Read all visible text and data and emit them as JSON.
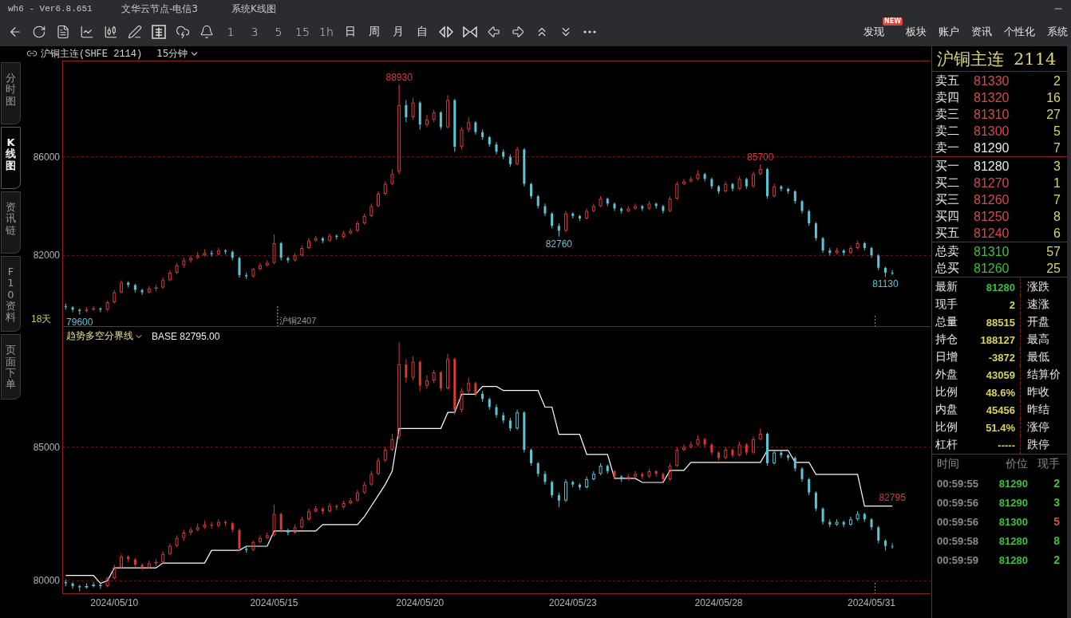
{
  "window": {
    "title": "wh6 - Ver6.8.651",
    "server": "文华云节点-电信3",
    "view": "系统K线图"
  },
  "toolbar": {
    "periods": [
      "1",
      "3",
      "5",
      "15",
      "1h",
      "日",
      "周",
      "月",
      "自"
    ],
    "menu": [
      {
        "label": "发现",
        "badge": "NEW"
      },
      {
        "label": "板块"
      },
      {
        "label": "账户"
      },
      {
        "label": "资讯"
      },
      {
        "label": "个性化"
      },
      {
        "label": "系统"
      }
    ]
  },
  "symbol_bar": {
    "symbol": "沪铜主连(SHFE 2114)",
    "period": "15分钟"
  },
  "side_tabs": [
    {
      "label": "分时图",
      "selected": false
    },
    {
      "label": "K线图",
      "selected": true
    },
    {
      "label": "资讯链",
      "selected": false
    },
    {
      "label": "F10资料",
      "selected": false
    },
    {
      "label": "页面下单",
      "selected": false
    }
  ],
  "price_chart": {
    "corner_label": "18天",
    "chart_data": {
      "type": "candlestick",
      "ohlc": [
        [
          79950,
          80050,
          79800,
          79900
        ],
        [
          79900,
          79950,
          79700,
          79800
        ],
        [
          79800,
          79850,
          79600,
          79750
        ],
        [
          79750,
          79900,
          79700,
          79800
        ],
        [
          79800,
          79950,
          79750,
          79850
        ],
        [
          79850,
          79900,
          79700,
          79800
        ],
        [
          79800,
          80150,
          79750,
          80100
        ],
        [
          80100,
          80600,
          80050,
          80500
        ],
        [
          80500,
          81000,
          80450,
          80900
        ],
        [
          80900,
          80950,
          80700,
          80800
        ],
        [
          80800,
          80850,
          80500,
          80600
        ],
        [
          80600,
          80650,
          80400,
          80500
        ],
        [
          80500,
          80750,
          80450,
          80650
        ],
        [
          80650,
          80800,
          80550,
          80700
        ],
        [
          80700,
          81100,
          80650,
          81000
        ],
        [
          81000,
          81400,
          80950,
          81300
        ],
        [
          81300,
          81700,
          81250,
          81600
        ],
        [
          81600,
          81900,
          81500,
          81800
        ],
        [
          81800,
          82000,
          81700,
          81900
        ],
        [
          81900,
          82150,
          81850,
          82000
        ],
        [
          82000,
          82250,
          81950,
          82100
        ],
        [
          82100,
          82200,
          81950,
          82050
        ],
        [
          82050,
          82300,
          82000,
          82200
        ],
        [
          82200,
          82250,
          82050,
          82150
        ],
        [
          82150,
          82200,
          81800,
          81900
        ],
        [
          81900,
          81950,
          81100,
          81200
        ],
        [
          81200,
          81300,
          81050,
          81150
        ],
        [
          81150,
          81500,
          81100,
          81450
        ],
        [
          81450,
          81700,
          81400,
          81600
        ],
        [
          81600,
          81800,
          81550,
          81700
        ],
        [
          81700,
          82850,
          81650,
          82500
        ],
        [
          82500,
          82550,
          81800,
          81900
        ],
        [
          81900,
          81950,
          81700,
          81800
        ],
        [
          81800,
          82100,
          81750,
          82000
        ],
        [
          82000,
          82400,
          81950,
          82300
        ],
        [
          82300,
          82700,
          82250,
          82600
        ],
        [
          82600,
          82800,
          82550,
          82700
        ],
        [
          82700,
          82750,
          82500,
          82600
        ],
        [
          82600,
          82900,
          82550,
          82800
        ],
        [
          82800,
          82850,
          82650,
          82750
        ],
        [
          82750,
          83000,
          82700,
          82900
        ],
        [
          82900,
          83100,
          82850,
          83000
        ],
        [
          83000,
          83400,
          82950,
          83300
        ],
        [
          83300,
          83700,
          83250,
          83600
        ],
        [
          83600,
          84100,
          83550,
          84000
        ],
        [
          84000,
          84600,
          83950,
          84500
        ],
        [
          84500,
          85000,
          84450,
          84900
        ],
        [
          84900,
          85500,
          84850,
          85300
        ],
        [
          85400,
          88930,
          85300,
          88100
        ],
        [
          88100,
          88300,
          87400,
          87600
        ],
        [
          87600,
          88400,
          87500,
          88200
        ],
        [
          88200,
          88250,
          87100,
          87300
        ],
        [
          87300,
          87700,
          87200,
          87500
        ],
        [
          87500,
          87900,
          87400,
          87800
        ],
        [
          87800,
          87850,
          87100,
          87200
        ],
        [
          87200,
          88500,
          87150,
          88300
        ],
        [
          88300,
          88350,
          86200,
          86400
        ],
        [
          86400,
          87200,
          86300,
          87100
        ],
        [
          87100,
          87600,
          87000,
          87400
        ],
        [
          87400,
          87450,
          86900,
          87000
        ],
        [
          87000,
          87100,
          86700,
          86800
        ],
        [
          86800,
          86850,
          86400,
          86500
        ],
        [
          86500,
          86600,
          86100,
          86200
        ],
        [
          86200,
          86300,
          85900,
          86000
        ],
        [
          86000,
          86100,
          85600,
          85700
        ],
        [
          85700,
          86400,
          85650,
          86300
        ],
        [
          86300,
          86350,
          84800,
          84900
        ],
        [
          84900,
          84950,
          84300,
          84400
        ],
        [
          84400,
          84450,
          83900,
          84000
        ],
        [
          84000,
          84100,
          83600,
          83700
        ],
        [
          83700,
          83750,
          83100,
          83200
        ],
        [
          83200,
          83300,
          82760,
          83000
        ],
        [
          83000,
          83800,
          82950,
          83700
        ],
        [
          83700,
          83750,
          83500,
          83600
        ],
        [
          83600,
          83650,
          83400,
          83500
        ],
        [
          83500,
          83900,
          83450,
          83800
        ],
        [
          83800,
          84100,
          83750,
          84000
        ],
        [
          84000,
          84400,
          83950,
          84300
        ],
        [
          84300,
          84350,
          84000,
          84100
        ],
        [
          84100,
          84150,
          83800,
          83900
        ],
        [
          83900,
          83950,
          83700,
          83800
        ],
        [
          83800,
          84000,
          83750,
          83900
        ],
        [
          83900,
          84100,
          83850,
          84000
        ],
        [
          84000,
          84050,
          83800,
          83900
        ],
        [
          83900,
          84200,
          83850,
          84100
        ],
        [
          84100,
          84150,
          83900,
          84000
        ],
        [
          84000,
          84050,
          83700,
          83800
        ],
        [
          83800,
          84400,
          83750,
          84300
        ],
        [
          84300,
          85000,
          84250,
          84900
        ],
        [
          84900,
          85100,
          84850,
          85000
        ],
        [
          85000,
          85200,
          84950,
          85100
        ],
        [
          85100,
          85450,
          85050,
          85300
        ],
        [
          85300,
          85350,
          85000,
          85100
        ],
        [
          85100,
          85150,
          84700,
          84800
        ],
        [
          84800,
          84850,
          84500,
          84600
        ],
        [
          84600,
          85000,
          84550,
          84900
        ],
        [
          84900,
          84950,
          84600,
          84700
        ],
        [
          84700,
          85200,
          84650,
          85100
        ],
        [
          85100,
          85150,
          84700,
          84800
        ],
        [
          84800,
          85400,
          84750,
          85300
        ],
        [
          85300,
          85700,
          85250,
          85500
        ],
        [
          85500,
          85550,
          84300,
          84400
        ],
        [
          84400,
          84900,
          84350,
          84800
        ],
        [
          84800,
          84850,
          84600,
          84700
        ],
        [
          84700,
          84750,
          84500,
          84600
        ],
        [
          84600,
          84650,
          84100,
          84200
        ],
        [
          84200,
          84250,
          83700,
          83800
        ],
        [
          83800,
          83850,
          83200,
          83300
        ],
        [
          83300,
          83350,
          82600,
          82700
        ],
        [
          82700,
          82750,
          82100,
          82200
        ],
        [
          82200,
          82300,
          82000,
          82100
        ],
        [
          82100,
          82300,
          82050,
          82200
        ],
        [
          82200,
          82250,
          82000,
          82100
        ],
        [
          82100,
          82400,
          82050,
          82300
        ],
        [
          82300,
          82600,
          82250,
          82500
        ],
        [
          82500,
          82550,
          82200,
          82300
        ],
        [
          82300,
          82350,
          81900,
          82000
        ],
        [
          82000,
          82050,
          81400,
          81500
        ],
        [
          81500,
          81550,
          81130,
          81300
        ],
        [
          81300,
          81400,
          81200,
          81280
        ]
      ],
      "categories": [
        null,
        null,
        null,
        null,
        null,
        null,
        null,
        "2024/05/10",
        null,
        null,
        null,
        null,
        null,
        null,
        null,
        null,
        null,
        null,
        null,
        null,
        null,
        null,
        null,
        null,
        null,
        null,
        null,
        null,
        null,
        null,
        "2024/05/15",
        null,
        null,
        null,
        null,
        null,
        null,
        null,
        null,
        null,
        null,
        null,
        null,
        null,
        null,
        null,
        null,
        null,
        null,
        null,
        null,
        "2024/05/20",
        null,
        null,
        null,
        null,
        null,
        null,
        null,
        null,
        null,
        null,
        null,
        null,
        null,
        null,
        null,
        null,
        null,
        null,
        null,
        null,
        null,
        "2024/05/23",
        null,
        null,
        null,
        null,
        null,
        null,
        null,
        null,
        null,
        null,
        null,
        null,
        null,
        null,
        null,
        null,
        null,
        null,
        null,
        null,
        "2024/05/28",
        null,
        null,
        null,
        null,
        null,
        null,
        null,
        null,
        null,
        null,
        null,
        null,
        null,
        null,
        null,
        null,
        null,
        null,
        null,
        null,
        null,
        "2024/05/31",
        null,
        null,
        null
      ],
      "ylim": [
        79100,
        89900
      ],
      "yticks": [
        82000,
        86000
      ],
      "tick_labels": "y",
      "grid": true,
      "ref_lines": [
        {
          "axis": "x",
          "value": "2024/05/15",
          "label": "沪铜2407",
          "line_style": "dotted"
        }
      ],
      "annotations": [
        "88930",
        "85700",
        "82760",
        "81130",
        "79600"
      ]
    }
  },
  "indicator": {
    "name": "趋势多空分界线",
    "base": "BASE 82795.00",
    "chart_data": {
      "type": "candlestick",
      "series": [
        {
          "type": "line",
          "color": "#ffffff",
          "values": [
            80200,
            80200,
            80200,
            80200,
            80200,
            79900,
            80000,
            80480,
            80480,
            80480,
            80480,
            80480,
            80480,
            80480,
            80660,
            80660,
            80660,
            80660,
            80660,
            80660,
            80660,
            81140,
            81140,
            81140,
            81140,
            81140,
            81290,
            81290,
            81290,
            81290,
            81860,
            81860,
            81860,
            81860,
            81860,
            81860,
            81860,
            82100,
            82100,
            82100,
            82100,
            82100,
            82100,
            82400,
            82800,
            83200,
            83600,
            84100,
            85700,
            85700,
            85700,
            85700,
            85700,
            85700,
            85700,
            86300,
            86300,
            86980,
            86980,
            86980,
            87270,
            87270,
            87270,
            87120,
            87120,
            87120,
            87120,
            87120,
            87120,
            86500,
            86500,
            85480,
            85480,
            85480,
            85480,
            84730,
            84730,
            84730,
            84730,
            83830,
            83830,
            83830,
            83830,
            83680,
            83680,
            83680,
            83680,
            84130,
            84130,
            84130,
            84430,
            84430,
            84430,
            84430,
            84430,
            84430,
            84430,
            84430,
            84430,
            84430,
            84430,
            84880,
            84880,
            84880,
            84880,
            84430,
            84430,
            84430,
            83980,
            83980,
            83980,
            83980,
            83980,
            83980,
            83980,
            82795,
            82795,
            82795,
            82795,
            82795
          ]
        },
        {
          "type": "candlestick",
          "color": "#d83a3a",
          "ohlc": [
            null,
            null,
            null,
            null,
            null,
            null,
            [
              79800,
              80150,
              79750,
              80100
            ],
            [
              80100,
              80600,
              80050,
              80500
            ],
            [
              80500,
              81000,
              80450,
              80900
            ],
            [
              80900,
              80950,
              80700,
              80800
            ],
            [
              80800,
              80850,
              80500,
              80600
            ],
            [
              80600,
              80650,
              80400,
              80500
            ],
            [
              80500,
              80750,
              80450,
              80650
            ],
            [
              80650,
              80800,
              80550,
              80700
            ],
            [
              80700,
              81100,
              80650,
              81000
            ],
            [
              81000,
              81400,
              80950,
              81300
            ],
            [
              81300,
              81700,
              81250,
              81600
            ],
            [
              81600,
              81900,
              81500,
              81800
            ],
            [
              81800,
              82000,
              81700,
              81900
            ],
            [
              81900,
              82150,
              81850,
              82000
            ],
            [
              82000,
              82250,
              81950,
              82100
            ],
            [
              82100,
              82200,
              81950,
              82050
            ],
            [
              82050,
              82300,
              82000,
              82200
            ],
            [
              82200,
              82250,
              82050,
              82150
            ],
            [
              82150,
              82200,
              81800,
              81900
            ],
            [
              81900,
              81950,
              81100,
              81200
            ],
            null,
            [
              81150,
              81500,
              81100,
              81450
            ],
            [
              81450,
              81700,
              81400,
              81600
            ],
            [
              81600,
              81800,
              81550,
              81700
            ],
            [
              81700,
              82850,
              81650,
              82500
            ],
            [
              82500,
              82550,
              81800,
              81900
            ],
            null,
            [
              81800,
              82100,
              81750,
              82000
            ],
            [
              82000,
              82400,
              81950,
              82300
            ],
            [
              82300,
              82700,
              82250,
              82600
            ],
            [
              82600,
              82800,
              82550,
              82700
            ],
            [
              82700,
              82750,
              82500,
              82600
            ],
            [
              82600,
              82900,
              82550,
              82800
            ],
            [
              82800,
              82850,
              82650,
              82750
            ],
            [
              82750,
              83000,
              82700,
              82900
            ],
            [
              82900,
              83100,
              82850,
              83000
            ],
            [
              83000,
              83400,
              82950,
              83300
            ],
            [
              83300,
              83700,
              83250,
              83600
            ],
            [
              83600,
              84100,
              83550,
              84000
            ],
            [
              84000,
              84600,
              83950,
              84500
            ],
            [
              84500,
              85000,
              84450,
              84900
            ],
            [
              84900,
              85500,
              84850,
              85300
            ],
            [
              85400,
              88930,
              85300,
              88100
            ],
            [
              88100,
              88300,
              87400,
              87600
            ],
            [
              87600,
              88400,
              87500,
              88200
            ],
            [
              88200,
              88250,
              87100,
              87300
            ],
            [
              87300,
              87700,
              87200,
              87500
            ],
            [
              87500,
              87900,
              87400,
              87800
            ],
            [
              87800,
              87850,
              87100,
              87200
            ],
            [
              87200,
              88500,
              87150,
              88300
            ],
            [
              88300,
              88350,
              86200,
              86400
            ],
            [
              86400,
              87200,
              86300,
              87100
            ],
            [
              87100,
              87600,
              87000,
              87400
            ],
            [
              87400,
              87450,
              86900,
              87000
            ],
            null,
            null,
            null,
            null,
            null,
            null,
            null,
            null,
            null,
            null,
            null,
            null,
            null,
            null,
            null,
            null,
            null,
            null,
            null,
            [
              84100,
              84150,
              83800,
              83900
            ],
            null,
            [
              83800,
              84000,
              83750,
              83900
            ],
            [
              83900,
              84100,
              83850,
              84000
            ],
            [
              84000,
              84050,
              83800,
              83900
            ],
            [
              83900,
              84200,
              83850,
              84100
            ],
            [
              84100,
              84150,
              83900,
              84000
            ],
            [
              84000,
              84050,
              83700,
              83800
            ],
            [
              83800,
              84400,
              83750,
              84300
            ],
            [
              84300,
              85000,
              84250,
              84900
            ],
            [
              84900,
              85100,
              84850,
              85000
            ],
            [
              85000,
              85200,
              84950,
              85100
            ],
            [
              85100,
              85450,
              85050,
              85300
            ],
            [
              85300,
              85350,
              85000,
              85100
            ],
            [
              85100,
              85150,
              84700,
              84800
            ],
            [
              84800,
              84850,
              84500,
              84600
            ],
            [
              84600,
              85000,
              84550,
              84900
            ],
            [
              84900,
              84950,
              84600,
              84700
            ],
            [
              84700,
              85200,
              84650,
              85100
            ],
            [
              85100,
              85150,
              84700,
              84800
            ],
            [
              84800,
              85400,
              84750,
              85300
            ],
            [
              85300,
              85700,
              85250,
              85500
            ],
            null,
            null,
            null,
            null,
            null,
            null,
            null,
            null,
            null,
            null,
            null,
            null,
            null,
            null,
            null,
            null,
            null,
            null,
            null
          ]
        },
        {
          "type": "candlestick",
          "color": "#5cc6d4",
          "ohlc": [
            [
              79950,
              80050,
              79800,
              79900
            ],
            [
              79900,
              79950,
              79700,
              79800
            ],
            [
              79800,
              79850,
              79600,
              79750
            ],
            [
              79750,
              79900,
              79700,
              79800
            ],
            [
              79800,
              79950,
              79750,
              79850
            ],
            [
              79850,
              79900,
              79700,
              79800
            ],
            null,
            null,
            null,
            null,
            null,
            null,
            null,
            null,
            null,
            null,
            null,
            null,
            null,
            null,
            null,
            null,
            null,
            null,
            null,
            null,
            [
              81200,
              81300,
              81050,
              81150
            ],
            null,
            null,
            null,
            null,
            null,
            [
              81900,
              81950,
              81700,
              81800
            ],
            null,
            null,
            null,
            null,
            null,
            null,
            null,
            null,
            null,
            null,
            null,
            null,
            null,
            null,
            null,
            null,
            null,
            null,
            null,
            null,
            null,
            null,
            null,
            null,
            null,
            null,
            null,
            [
              87000,
              87100,
              86700,
              86800
            ],
            [
              86800,
              86850,
              86400,
              86500
            ],
            [
              86500,
              86600,
              86100,
              86200
            ],
            [
              86200,
              86300,
              85900,
              86000
            ],
            [
              86000,
              86100,
              85600,
              85700
            ],
            [
              85700,
              86400,
              85650,
              86300
            ],
            [
              86300,
              86350,
              84800,
              84900
            ],
            [
              84900,
              84950,
              84300,
              84400
            ],
            [
              84400,
              84450,
              83900,
              84000
            ],
            [
              84000,
              84100,
              83600,
              83700
            ],
            [
              83700,
              83750,
              83100,
              83200
            ],
            [
              83200,
              83300,
              82760,
              83000
            ],
            [
              83000,
              83800,
              82950,
              83700
            ],
            [
              83700,
              83750,
              83500,
              83600
            ],
            [
              83600,
              83650,
              83400,
              83500
            ],
            [
              83500,
              83900,
              83450,
              83800
            ],
            [
              83800,
              84100,
              83750,
              84000
            ],
            [
              84000,
              84400,
              83950,
              84300
            ],
            [
              84300,
              84350,
              84000,
              84100
            ],
            null,
            [
              83900,
              83950,
              83700,
              83800
            ],
            null,
            null,
            null,
            null,
            null,
            null,
            null,
            null,
            null,
            null,
            null,
            null,
            null,
            null,
            null,
            null,
            null,
            null,
            null,
            null,
            [
              85500,
              85550,
              84300,
              84400
            ],
            [
              84400,
              84900,
              84350,
              84800
            ],
            [
              84800,
              84850,
              84600,
              84700
            ],
            [
              84700,
              84750,
              84500,
              84600
            ],
            [
              84600,
              84650,
              84100,
              84200
            ],
            [
              84200,
              84250,
              83700,
              83800
            ],
            [
              83800,
              83850,
              83200,
              83300
            ],
            [
              83300,
              83350,
              82600,
              82700
            ],
            [
              82700,
              82750,
              82100,
              82200
            ],
            [
              82200,
              82300,
              82000,
              82100
            ],
            [
              82100,
              82300,
              82050,
              82200
            ],
            [
              82200,
              82250,
              82000,
              82100
            ],
            [
              82100,
              82400,
              82050,
              82300
            ],
            [
              82300,
              82600,
              82250,
              82500
            ],
            [
              82500,
              82550,
              82200,
              82300
            ],
            [
              82300,
              82350,
              81900,
              82000
            ],
            [
              82000,
              82050,
              81400,
              81500
            ],
            [
              81500,
              81550,
              81130,
              81300
            ],
            [
              81300,
              81400,
              81200,
              81280
            ]
          ]
        }
      ],
      "categories": [
        null,
        null,
        null,
        null,
        null,
        null,
        null,
        "2024/05/10",
        null,
        null,
        null,
        null,
        null,
        null,
        null,
        null,
        null,
        null,
        null,
        null,
        null,
        null,
        null,
        null,
        null,
        null,
        null,
        null,
        null,
        null,
        "2024/05/15",
        null,
        null,
        null,
        null,
        null,
        null,
        null,
        null,
        null,
        null,
        null,
        null,
        null,
        null,
        null,
        null,
        null,
        null,
        null,
        null,
        "2024/05/20",
        null,
        null,
        null,
        null,
        null,
        null,
        null,
        null,
        null,
        null,
        null,
        null,
        null,
        null,
        null,
        null,
        null,
        null,
        null,
        null,
        null,
        "2024/05/23",
        null,
        null,
        null,
        null,
        null,
        null,
        null,
        null,
        null,
        null,
        null,
        null,
        null,
        null,
        null,
        null,
        null,
        null,
        null,
        null,
        "2024/05/28",
        null,
        null,
        null,
        null,
        null,
        null,
        null,
        null,
        null,
        null,
        null,
        null,
        null,
        null,
        null,
        null,
        null,
        null,
        null,
        null,
        null,
        "2024/05/31",
        null,
        null,
        null
      ],
      "ylim": [
        79500,
        89500
      ],
      "yticks": [
        80000,
        85000
      ],
      "grid": true,
      "annotations": [
        "82795"
      ]
    }
  },
  "quote_panel": {
    "name": "沪铜主连",
    "code": "2114",
    "asks": [
      {
        "label": "卖五",
        "price": "81330",
        "volume": "2",
        "color": "#d24b4b"
      },
      {
        "label": "卖四",
        "price": "81320",
        "volume": "16",
        "color": "#d24b4b"
      },
      {
        "label": "卖三",
        "price": "81310",
        "volume": "27",
        "color": "#d24b4b"
      },
      {
        "label": "卖二",
        "price": "81300",
        "volume": "5",
        "color": "#d24b4b"
      },
      {
        "label": "卖一",
        "price": "81290",
        "volume": "7",
        "color": "#e6e6e6"
      }
    ],
    "bids": [
      {
        "label": "买一",
        "price": "81280",
        "volume": "3",
        "color": "#e6e6e6"
      },
      {
        "label": "买二",
        "price": "81270",
        "volume": "1",
        "color": "#d24b4b"
      },
      {
        "label": "买三",
        "price": "81260",
        "volume": "7",
        "color": "#d24b4b"
      },
      {
        "label": "买四",
        "price": "81250",
        "volume": "8",
        "color": "#d24b4b"
      },
      {
        "label": "买五",
        "price": "81240",
        "volume": "6",
        "color": "#d24b4b"
      }
    ],
    "totals": [
      {
        "label": "总卖",
        "price": "81310",
        "volume": "57",
        "color": "#3cbf3c"
      },
      {
        "label": "总买",
        "price": "81260",
        "volume": "25",
        "color": "#3cbf3c"
      }
    ],
    "stats": [
      {
        "label": "最新",
        "value": "81280",
        "color": "#3cbf3c",
        "right_label": "涨跌"
      },
      {
        "label": "现手",
        "value": "2",
        "color": "#d6d45a",
        "right_label": "速涨"
      },
      {
        "label": "总量",
        "value": "88515",
        "color": "#d6d45a",
        "right_label": "开盘"
      },
      {
        "label": "持仓",
        "value": "188127",
        "color": "#d6d45a",
        "right_label": "最高"
      },
      {
        "label": "日增",
        "value": "-3872",
        "color": "#d6d45a",
        "right_label": "最低"
      },
      {
        "label": "外盘",
        "value": "43059",
        "color": "#d6d45a",
        "right_label": "结算价"
      },
      {
        "label": "比例",
        "value": "48.6%",
        "color": "#d6d45a",
        "right_label": "昨收"
      },
      {
        "label": "内盘",
        "value": "45456",
        "color": "#d6d45a",
        "right_label": "昨结"
      },
      {
        "label": "比例",
        "value": "51.4%",
        "color": "#d6d45a",
        "right_label": "涨停"
      },
      {
        "label": "杠杆",
        "value": "-----",
        "color": "#d6d45a",
        "right_label": "跌停"
      }
    ],
    "tick_columns": [
      "时间",
      "价位",
      "现手"
    ],
    "ticks": [
      {
        "time": "00:59:55",
        "price": "81290",
        "volume": "2",
        "color": "#3cbf3c"
      },
      {
        "time": "00:59:56",
        "price": "81290",
        "volume": "3",
        "color": "#3cbf3c"
      },
      {
        "time": "00:59:56",
        "price": "81300",
        "volume": "5",
        "color": "#d24b4b"
      },
      {
        "time": "00:59:58",
        "price": "81280",
        "volume": "8",
        "color": "#3cbf3c"
      },
      {
        "time": "00:59:59",
        "price": "81280",
        "volume": "2",
        "color": "#3cbf3c"
      }
    ]
  }
}
